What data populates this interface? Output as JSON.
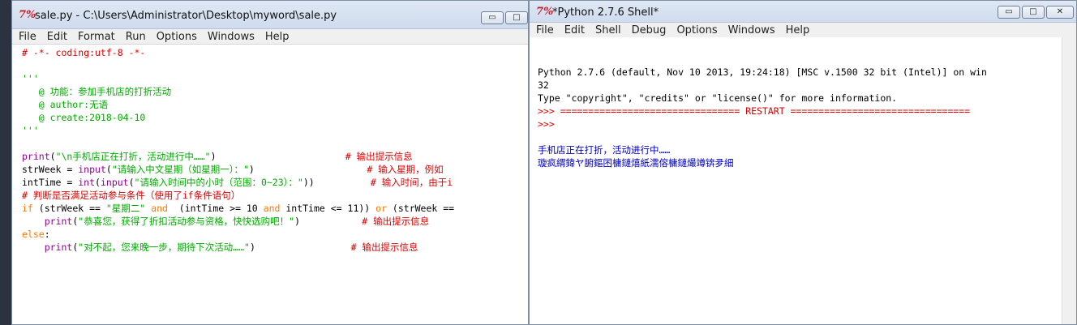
{
  "editor": {
    "title": "sale.py - C:\\Users\\Administrator\\Desktop\\myword\\sale.py",
    "menu": [
      "File",
      "Edit",
      "Format",
      "Run",
      "Options",
      "Windows",
      "Help"
    ],
    "lines": [
      [
        {
          "t": "# -*- coding:utf-8 -*-",
          "c": "c-comment"
        }
      ],
      [],
      [
        {
          "t": "'''",
          "c": "c-str"
        }
      ],
      [
        {
          "t": "   @ 功能：参加手机店的打折活动",
          "c": "c-str"
        }
      ],
      [
        {
          "t": "   @ author:无语",
          "c": "c-str"
        }
      ],
      [
        {
          "t": "   @ create:2018-04-10",
          "c": "c-str"
        }
      ],
      [
        {
          "t": "'''",
          "c": "c-str"
        }
      ],
      [],
      [
        {
          "t": "print",
          "c": "c-bi"
        },
        {
          "t": "(",
          "c": "c-def"
        },
        {
          "t": "\"\\n手机店正在打折，活动进行中……\"",
          "c": "c-str"
        },
        {
          "t": ")                       ",
          "c": "c-def"
        },
        {
          "t": "# 输出提示信息",
          "c": "c-comment"
        }
      ],
      [
        {
          "t": "strWeek = ",
          "c": "c-def"
        },
        {
          "t": "input",
          "c": "c-bi"
        },
        {
          "t": "(",
          "c": "c-def"
        },
        {
          "t": "\"请输入中文星期（如星期一）：\"",
          "c": "c-str"
        },
        {
          "t": ")                    ",
          "c": "c-def"
        },
        {
          "t": "# 输入星期，例如",
          "c": "c-comment"
        }
      ],
      [
        {
          "t": "intTime = ",
          "c": "c-def"
        },
        {
          "t": "int",
          "c": "c-bi"
        },
        {
          "t": "(",
          "c": "c-def"
        },
        {
          "t": "input",
          "c": "c-bi"
        },
        {
          "t": "(",
          "c": "c-def"
        },
        {
          "t": "\"请输入时间中的小时（范围：0~23）：\"",
          "c": "c-str"
        },
        {
          "t": "))          ",
          "c": "c-def"
        },
        {
          "t": "# 输入时间，由于i",
          "c": "c-comment"
        }
      ],
      [
        {
          "t": "# 判断是否满足活动参与条件（使用了if条件语句）",
          "c": "c-comment"
        }
      ],
      [
        {
          "t": "if",
          "c": "c-kw"
        },
        {
          "t": " (strWeek == ",
          "c": "c-def"
        },
        {
          "t": "\"星期二\"",
          "c": "c-str"
        },
        {
          "t": " ",
          "c": "c-def"
        },
        {
          "t": "and",
          "c": "c-kw"
        },
        {
          "t": "  (intTime >= 10 ",
          "c": "c-def"
        },
        {
          "t": "and",
          "c": "c-kw"
        },
        {
          "t": " intTime <= 11)) ",
          "c": "c-def"
        },
        {
          "t": "or",
          "c": "c-kw"
        },
        {
          "t": " (strWeek ==",
          "c": "c-def"
        }
      ],
      [
        {
          "t": "    ",
          "c": "c-def"
        },
        {
          "t": "print",
          "c": "c-bi"
        },
        {
          "t": "(",
          "c": "c-def"
        },
        {
          "t": "\"恭喜您，获得了折扣活动参与资格，快快选购吧！\"",
          "c": "c-str"
        },
        {
          "t": ")           ",
          "c": "c-def"
        },
        {
          "t": "# 输出提示信息",
          "c": "c-comment"
        }
      ],
      [
        {
          "t": "else",
          "c": "c-kw"
        },
        {
          "t": ":",
          "c": "c-def"
        }
      ],
      [
        {
          "t": "    ",
          "c": "c-def"
        },
        {
          "t": "print",
          "c": "c-bi"
        },
        {
          "t": "(",
          "c": "c-def"
        },
        {
          "t": "\"对不起，您来晚一步，期待下次活动……\"",
          "c": "c-str"
        },
        {
          "t": ")                 ",
          "c": "c-def"
        },
        {
          "t": "# 输出提示信息",
          "c": "c-comment"
        }
      ]
    ]
  },
  "shell": {
    "title": "*Python 2.7.6 Shell*",
    "menu": [
      "File",
      "Edit",
      "Shell",
      "Debug",
      "Options",
      "Windows",
      "Help"
    ],
    "lines": [
      [
        {
          "t": "Python 2.7.6 (default, Nov 10 2013, 19:24:18) [MSC v.1500 32 bit (Intel)] on win",
          "c": "c-shell"
        }
      ],
      [
        {
          "t": "32",
          "c": "c-shell"
        }
      ],
      [
        {
          "t": "Type \"copyright\", \"credits\" or \"license()\" for more information.",
          "c": "c-shell"
        }
      ],
      [
        {
          "t": ">>> ================================ RESTART ================================",
          "c": "c-comment"
        }
      ],
      [
        {
          "t": ">>> ",
          "c": "c-comment"
        }
      ],
      [],
      [
        {
          "t": "手机店正在打折，活动进行中……",
          "c": "c-out"
        }
      ],
      [
        {
          "t": "璇疯緭鍏ヤ腑鏂囨槦鏈熺紙濡傛槦鏈熶竴锛夛細",
          "c": "c-out"
        }
      ]
    ]
  },
  "window_buttons": {
    "minimize": "▭",
    "maximize": "□",
    "close": "✕"
  }
}
